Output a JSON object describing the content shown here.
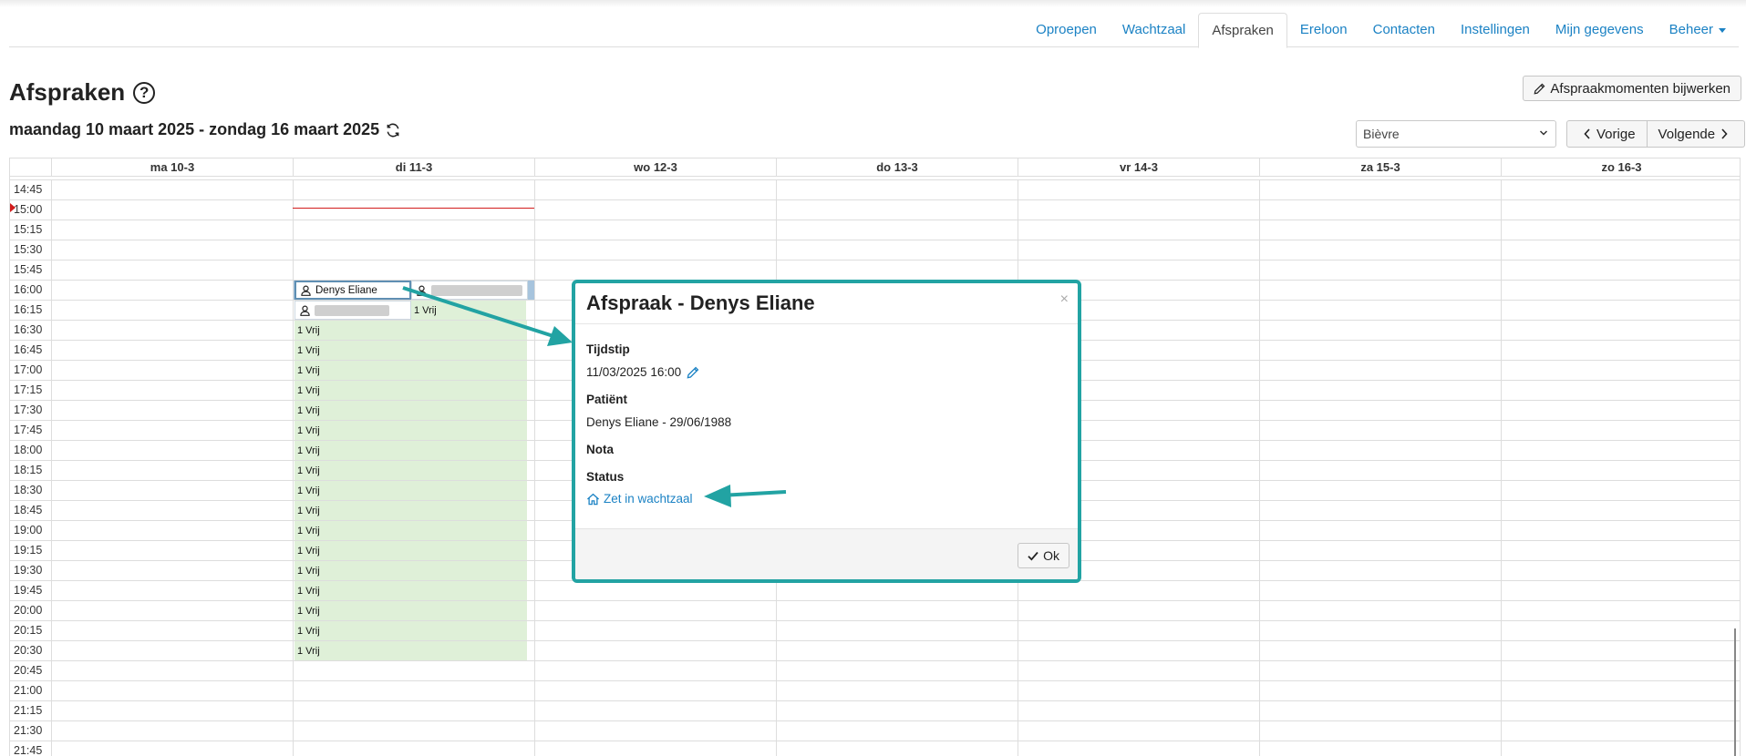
{
  "nav": {
    "items": [
      {
        "label": "Oproepen",
        "active": false
      },
      {
        "label": "Wachtzaal",
        "active": false
      },
      {
        "label": "Afspraken",
        "active": true
      },
      {
        "label": "Ereloon",
        "active": false
      },
      {
        "label": "Contacten",
        "active": false
      },
      {
        "label": "Instellingen",
        "active": false
      },
      {
        "label": "Mijn gegevens",
        "active": false
      },
      {
        "label": "Beheer",
        "active": false,
        "dropdown": true
      }
    ]
  },
  "page": {
    "title": "Afspraken",
    "help_icon": "question-circle-icon",
    "date_range": "maandag 10 maart 2025 - zondag 16 maart 2025",
    "refresh_icon": "refresh-icon",
    "edit_button": "Afspraakmomenten bijwerken",
    "location_select": "Bièvre",
    "prev_button": "Vorige",
    "next_button": "Volgende"
  },
  "calendar": {
    "days": [
      "ma 10-3",
      "di 11-3",
      "wo 12-3",
      "do 13-3",
      "vr 14-3",
      "za 15-3",
      "zo 16-3"
    ],
    "times": [
      "14:45",
      "15:00",
      "15:15",
      "15:30",
      "15:45",
      "16:00",
      "16:15",
      "16:30",
      "16:45",
      "17:00",
      "17:15",
      "17:30",
      "17:45",
      "18:00",
      "18:15",
      "18:30",
      "18:45",
      "19:00",
      "19:15",
      "19:30",
      "19:45",
      "20:00",
      "20:15",
      "20:30",
      "20:45",
      "21:00",
      "21:15",
      "21:30",
      "21:45"
    ],
    "appointments": [
      {
        "name": "Denys Eliane",
        "selected": true
      },
      {
        "name": "",
        "redacted": true
      },
      {
        "name": "",
        "redacted": true
      }
    ],
    "free_label": "1 Vrij"
  },
  "modal": {
    "title": "Afspraak - Denys Eliane",
    "close": "×",
    "time_label": "Tijdstip",
    "time_value": "11/03/2025 16:00",
    "patient_label": "Patiënt",
    "patient_value": "Denys Eliane - 29/06/1988",
    "note_label": "Nota",
    "status_label": "Status",
    "status_link": "Zet in wachtzaal",
    "ok_button": "Ok"
  },
  "colors": {
    "link": "#1b82c4",
    "free_slot": "#dff0d8",
    "now_line": "#d21c1c",
    "annotation": "#22a3a3"
  }
}
